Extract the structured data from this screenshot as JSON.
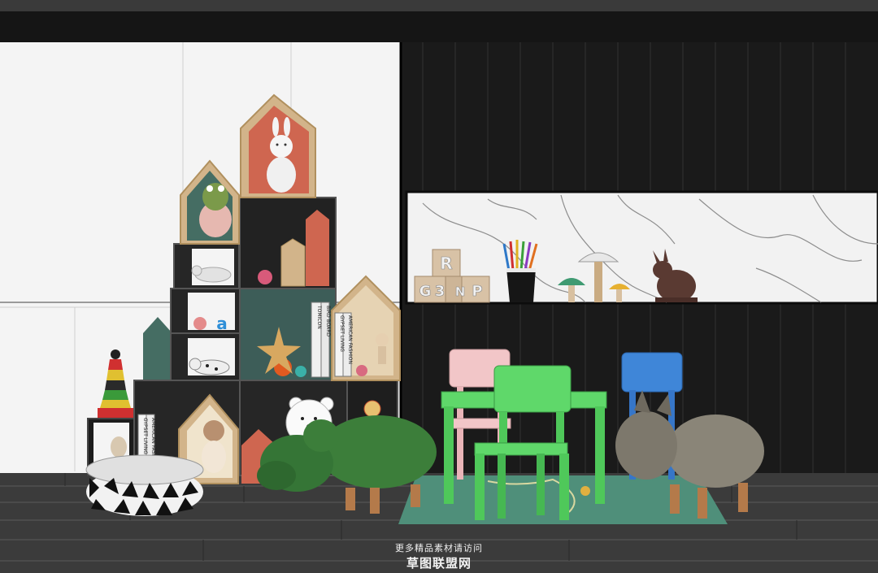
{
  "scene": {
    "blocks": {
      "top_left": "R",
      "bottom_left": "G",
      "bottom_mid": "N",
      "bottom_right": "P",
      "side": "3"
    },
    "cube_letter": "a",
    "book_spines": {
      "tall_book": "TOMICON",
      "book_2": "BIRD BOARD",
      "book_3": "GYPSET LIVING",
      "book_4": "AMERICAN FASHION",
      "low_book_1": "GYPSET LIVING",
      "low_book_2": "AMERICAN FASHION"
    }
  },
  "watermark": {
    "line1": "更多精品素材请访问",
    "line2": "草图联盟网"
  }
}
